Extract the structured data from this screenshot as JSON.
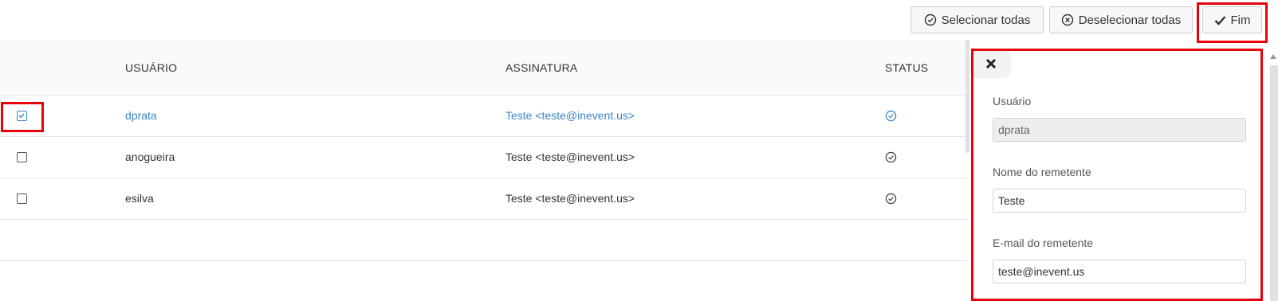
{
  "toolbar": {
    "select_all_label": "Selecionar todas",
    "deselect_all_label": "Deselecionar todas",
    "finish_label": "Fim"
  },
  "table": {
    "headers": {
      "user": "USUÁRIO",
      "signature": "ASSINATURA",
      "status": "STATUS"
    },
    "rows": [
      {
        "user": "dprata",
        "signature": "Teste <teste@inevent.us>",
        "checked": true,
        "status_icon": "check-circle-icon"
      },
      {
        "user": "anogueira",
        "signature": "Teste <teste@inevent.us>",
        "checked": false,
        "status_icon": "check-circle-icon"
      },
      {
        "user": "esilva",
        "signature": "Teste <teste@inevent.us>",
        "checked": false,
        "status_icon": "check-circle-icon"
      }
    ]
  },
  "panel": {
    "close_icon": "close-icon",
    "user_label": "Usuário",
    "user_value": "dprata",
    "sender_name_label": "Nome do remetente",
    "sender_name_value": "Teste",
    "sender_email_label": "E-mail do remetente",
    "sender_email_value": "teste@inevent.us"
  },
  "colors": {
    "highlight_frame": "#e8000b",
    "link": "#3a86c8"
  }
}
